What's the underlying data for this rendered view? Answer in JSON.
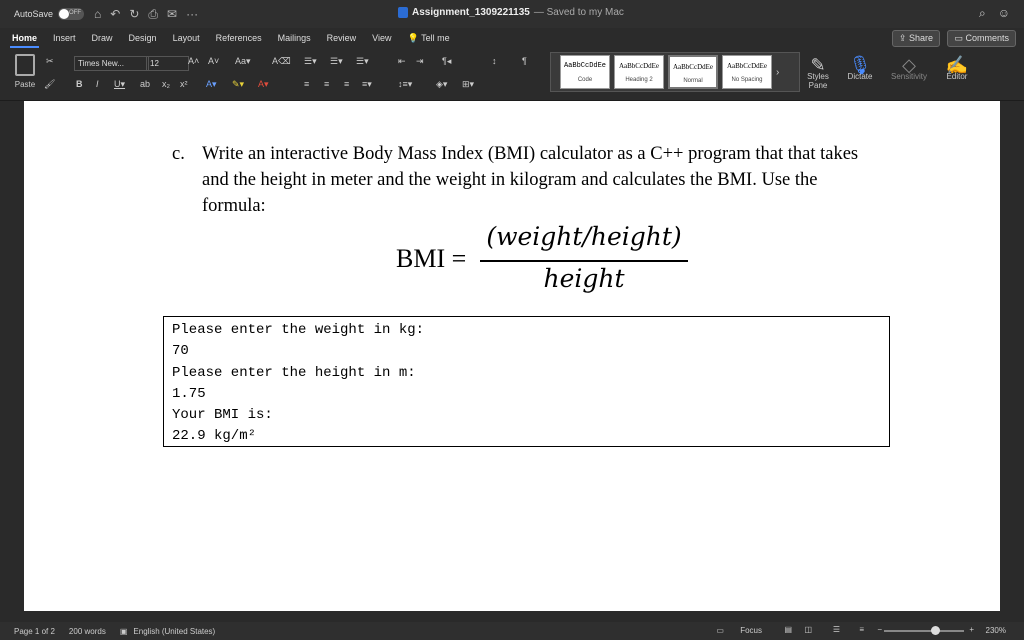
{
  "titlebar": {
    "autosave_label": "AutoSave",
    "autosave_state": "OFF",
    "doc_name": "Assignment_1309221135",
    "doc_status": "— Saved to my Mac"
  },
  "tabs": [
    "Home",
    "Insert",
    "Draw",
    "Design",
    "Layout",
    "References",
    "Mailings",
    "Review",
    "View"
  ],
  "tell_me": "Tell me",
  "share_label": "Share",
  "comments_label": "Comments",
  "ribbon": {
    "paste_label": "Paste",
    "font_name": "Times New...",
    "font_size": "12",
    "styles": [
      {
        "sample": "AaBbCcDdEe",
        "name": "Code"
      },
      {
        "sample": "AaBbCcDdEe",
        "name": "Heading 2"
      },
      {
        "sample": "AaBbCcDdEe",
        "name": "Normal"
      },
      {
        "sample": "AaBbCcDdEe",
        "name": "No Spacing"
      }
    ],
    "styles_pane_label": "Styles Pane",
    "dictate_label": "Dictate",
    "sensitivity_label": "Sensitivity",
    "editor_label": "Editor"
  },
  "document": {
    "question_label": "c.",
    "question_text": "Write an interactive Body Mass Index (BMI) calculator as a C++ program that that takes and the height in meter and the weight in kilogram and calculates the BMI. Use the formula:",
    "formula_lhs": "BMI =",
    "formula_numerator": "(weight/height)",
    "formula_denominator": "height",
    "console_lines": [
      "Please enter the weight in kg:",
      "70",
      "Please enter the height in m:",
      "1.75",
      "Your BMI is:",
      "22.9 kg/m²"
    ]
  },
  "statusbar": {
    "page": "Page 1 of 2",
    "words": "200 words",
    "language": "English (United States)",
    "focus": "Focus",
    "zoom": "230%"
  }
}
